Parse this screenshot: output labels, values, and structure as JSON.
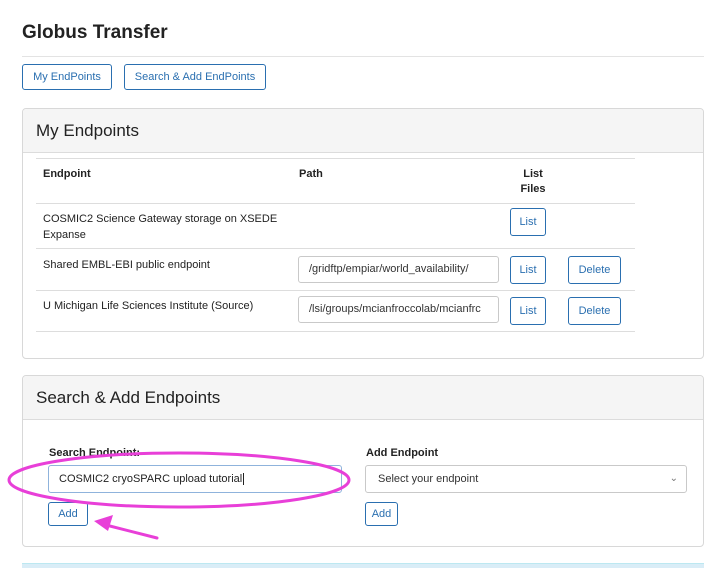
{
  "page": {
    "title": "Globus Transfer"
  },
  "nav": {
    "my_endpoints_label": "My EndPoints",
    "search_add_label": "Search & Add EndPoints"
  },
  "my_endpoints": {
    "heading": "My Endpoints",
    "headers": {
      "endpoint": "Endpoint",
      "path": "Path",
      "list_files": "List Files"
    },
    "rows": [
      {
        "endpoint": "COSMIC2 Science Gateway storage on XSEDE Expanse",
        "path": "",
        "list_label": "List",
        "delete_label": ""
      },
      {
        "endpoint": "Shared EMBL-EBI public endpoint",
        "path": "/gridftp/empiar/world_availability/",
        "list_label": "List",
        "delete_label": "Delete"
      },
      {
        "endpoint": "U Michigan Life Sciences Institute (Source)",
        "path": "/lsi/groups/mcianfroccolab/mcianfrc",
        "list_label": "List",
        "delete_label": "Delete"
      }
    ]
  },
  "search_add": {
    "heading": "Search & Add Endpoints",
    "search_label": "Search Endpoint:",
    "search_value": "COSMIC2 cryoSPARC upload tutorial",
    "search_add_label": "Add",
    "add_label": "Add Endpoint",
    "select_value": "Select your endpoint",
    "add_button_label": "Add"
  },
  "annotations": {
    "highlight_color": "#e83fd8",
    "arrow_color": "#e83fd8"
  }
}
